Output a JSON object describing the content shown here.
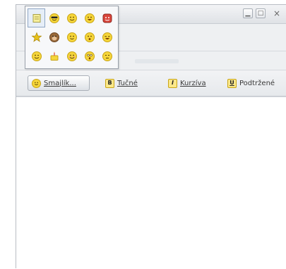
{
  "window": {
    "minimize_glyph": "▁",
    "maximize_glyph": "□",
    "close_glyph": "×"
  },
  "toolbar": {
    "buttons": [
      {
        "label": "Smajlík...",
        "icon": "smiley-icon",
        "icon_glyph": "",
        "pressed": true
      },
      {
        "label": "Tučné",
        "icon": "bold-icon",
        "icon_glyph": "B",
        "pressed": false
      },
      {
        "label": "Kurzíva",
        "icon": "italic-icon",
        "icon_glyph": "I",
        "pressed": false
      },
      {
        "label": "Podtržené",
        "icon": "underline-icon",
        "icon_glyph": "U",
        "pressed": false
      }
    ]
  },
  "emoticons": {
    "rows": [
      [
        "note-icon",
        "cool-sunglasses-icon",
        "smile-icon",
        "grin-icon",
        "devil-icon"
      ],
      [
        "star-icon",
        "monkey-icon",
        "happy-icon",
        "surprised-icon",
        "laugh-icon"
      ],
      [
        "wink-icon",
        "cake-icon",
        "blush-icon",
        "shocked-icon",
        "sleepy-icon"
      ]
    ],
    "colors": {
      "face": "#f5d53a",
      "outline": "#c9a516",
      "devil": "#d9453b",
      "monkey": "#9a6a3a",
      "note": "#f7ef9c",
      "star": "#e8c21a"
    }
  }
}
